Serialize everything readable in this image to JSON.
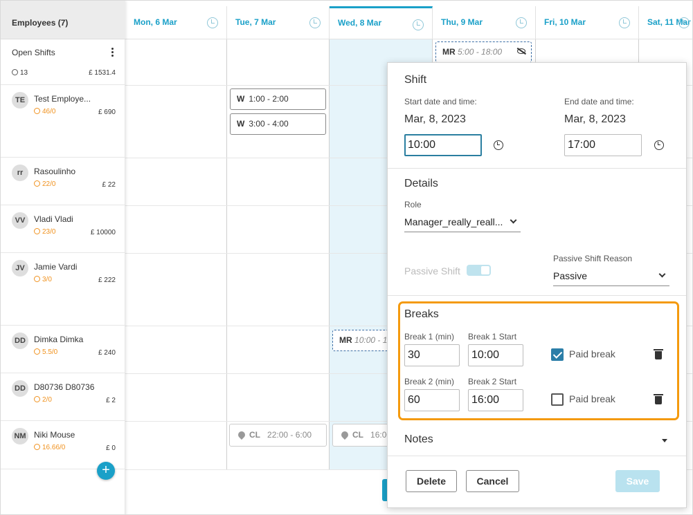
{
  "employees_header": "Employees (7)",
  "open_shifts": {
    "label": "Open Shifts",
    "count": "13",
    "cost": "£ 1531.4"
  },
  "employees": [
    {
      "initials": "TE",
      "name": "Test Employe...",
      "hours": "46/0",
      "cost": "£ 690"
    },
    {
      "initials": "rr",
      "name": "Rasoulinho",
      "hours": "22/0",
      "cost": "£ 22"
    },
    {
      "initials": "VV",
      "name": "Vladi Vladi",
      "hours": "23/0",
      "cost": "£ 10000"
    },
    {
      "initials": "JV",
      "name": "Jamie Vardi",
      "hours": "3/0",
      "cost": "£ 222"
    },
    {
      "initials": "DD",
      "name": "Dimka Dimka",
      "hours": "5.5/0",
      "cost": "£ 240"
    },
    {
      "initials": "DD",
      "name": "D80736 D80736",
      "hours": "2/0",
      "cost": "£ 2"
    },
    {
      "initials": "NM",
      "name": "Niki Mouse",
      "hours": "16.66/0",
      "cost": "£ 0"
    }
  ],
  "days": [
    "Mon, 6 Mar",
    "Tue, 7 Mar",
    "Wed, 8 Mar",
    "Thu, 9 Mar",
    "Fri, 10 Mar",
    "Sat, 11 Mar"
  ],
  "shifts": {
    "open_thu": {
      "role": "MR",
      "time": "5:00 - 18:00"
    },
    "te_tue_1": {
      "role": "W",
      "time": "1:00 - 2:00"
    },
    "te_tue_2": {
      "role": "W",
      "time": "3:00 - 4:00"
    },
    "dd_wed": {
      "role": "MR",
      "time": "10:00 - 1"
    },
    "nm_tue": {
      "role": "CL",
      "time": "22:00 - 6:00"
    },
    "nm_wed": {
      "role": "CL",
      "time": "16:00"
    }
  },
  "panel": {
    "shift_title": "Shift",
    "start_label": "Start date and time:",
    "start_date": "Mar, 8, 2023",
    "start_time": "10:00",
    "end_label": "End date and time:",
    "end_date": "Mar, 8, 2023",
    "end_time": "17:00",
    "details_title": "Details",
    "role_label": "Role",
    "role_value": "Manager_really_reall...",
    "passive_shift_label": "Passive Shift",
    "passive_reason_label": "Passive Shift Reason",
    "passive_reason_value": "Passive",
    "breaks_title": "Breaks",
    "breaks": [
      {
        "dur_label": "Break 1 (min)",
        "dur": "30",
        "start_label": "Break 1 Start",
        "start": "10:00",
        "paid_label": "Paid break",
        "paid": true
      },
      {
        "dur_label": "Break 2 (min)",
        "dur": "60",
        "start_label": "Break 2 Start",
        "start": "16:00",
        "paid_label": "Paid break",
        "paid": false
      }
    ],
    "notes_title": "Notes",
    "delete_label": "Delete",
    "cancel_label": "Cancel",
    "save_label": "Save"
  },
  "colors": {
    "accent": "#1aa0c8",
    "highlight": "#f49a0e",
    "hours": "#f0911d"
  }
}
